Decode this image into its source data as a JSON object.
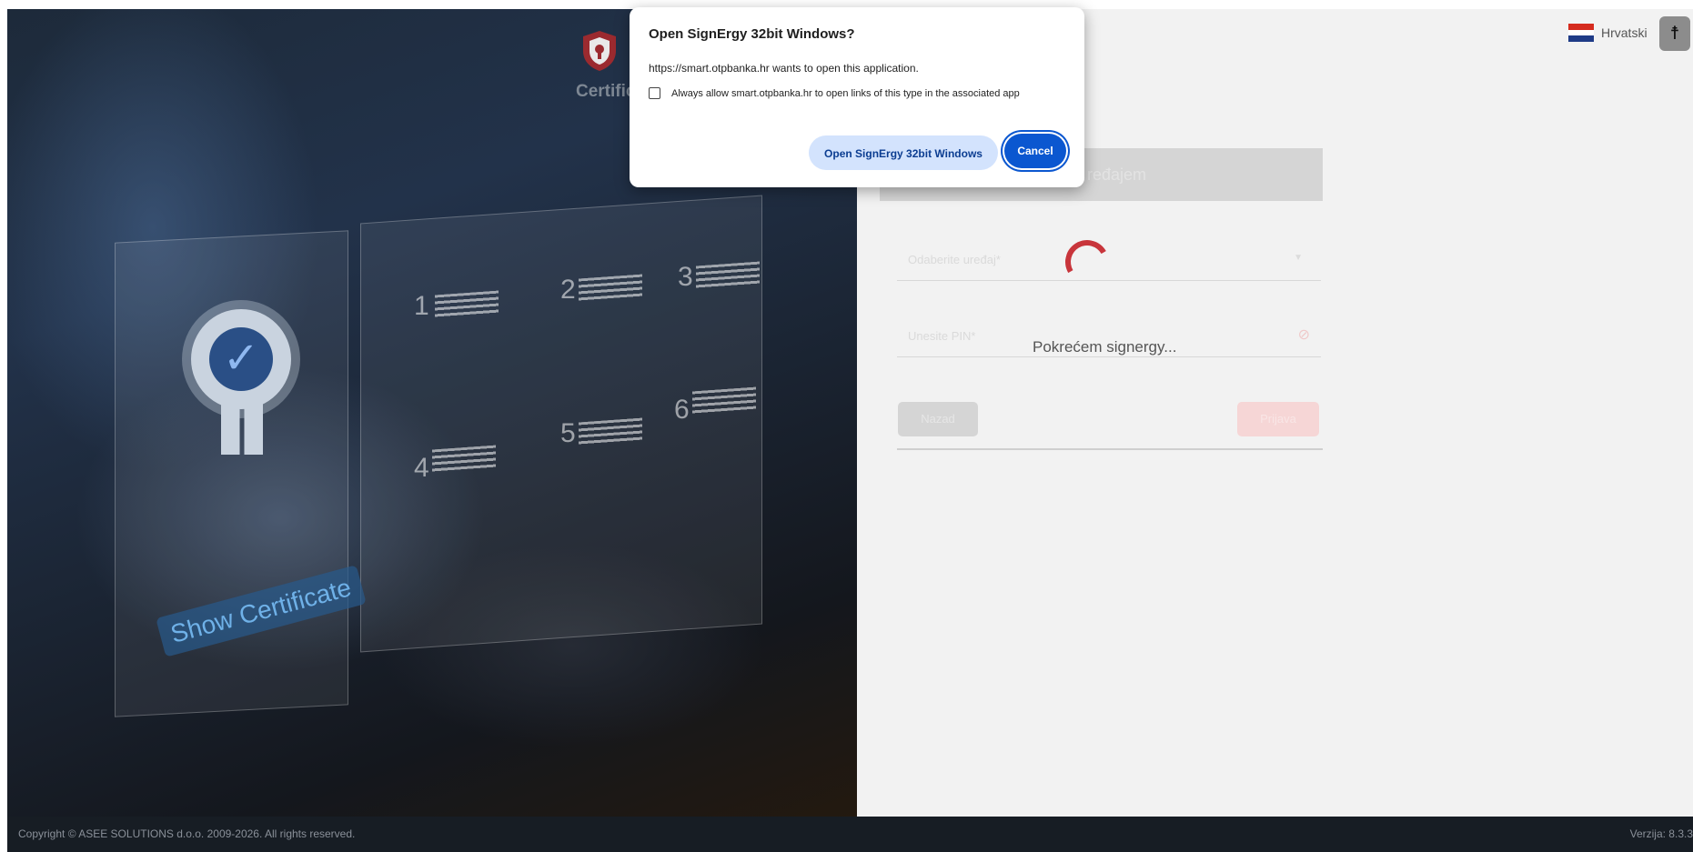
{
  "dialog": {
    "title": "Open SignErgy 32bit Windows?",
    "message": "https://smart.otpbanka.hr wants to open this application.",
    "checkbox_label": "Always allow smart.otpbanka.hr to open links of this type in the associated app",
    "checkbox_checked": false,
    "open_button": "Open SignErgy 32bit Windows",
    "cancel_button": "Cancel"
  },
  "hero": {
    "title_partial": "Certific",
    "show_certificate": "Show Certificate",
    "numbers": [
      "1",
      "2",
      "3",
      "4",
      "5",
      "6"
    ]
  },
  "form": {
    "header_partial": "ređajem",
    "device_placeholder": "Odaberite uređaj*",
    "pin_placeholder": "Unesite PIN*",
    "back_button": "Nazad",
    "login_button": "Prijava",
    "loading_text": "Pokrećem signergy..."
  },
  "language": {
    "label": "Hrvatski"
  },
  "footer": {
    "copyright": "Copyright © ASEE SOLUTIONS d.o.o. 2009-2026. All rights reserved.",
    "version": "Verzija: 8.3.3"
  },
  "colors": {
    "accent_red": "#c8353b",
    "dialog_primary": "#0b57d0",
    "footer_bg": "#171d24"
  }
}
